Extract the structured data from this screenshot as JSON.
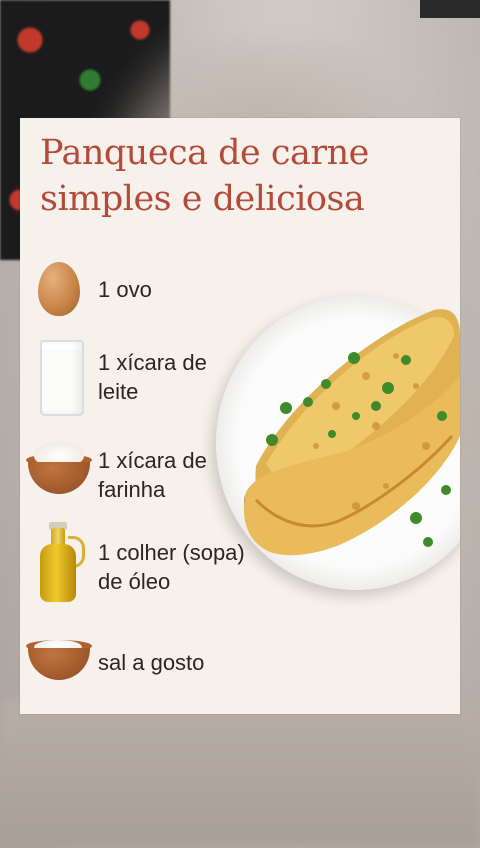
{
  "card": {
    "title": "Panqueca de carne simples e deliciosa",
    "ingredients": [
      {
        "icon": "egg-icon",
        "label": "1 ovo"
      },
      {
        "icon": "milk-glass-icon",
        "label": "1 xícara de leite"
      },
      {
        "icon": "flour-bowl-icon",
        "label": "1 xícara de farinha"
      },
      {
        "icon": "oil-bottle-icon",
        "label": "1 colher (sopa) de óleo"
      },
      {
        "icon": "salt-bowl-icon",
        "label": "sal a gosto"
      }
    ]
  },
  "colors": {
    "title": "#b44a3a",
    "card_background": "#f6f1ea",
    "text": "#2b2622"
  }
}
